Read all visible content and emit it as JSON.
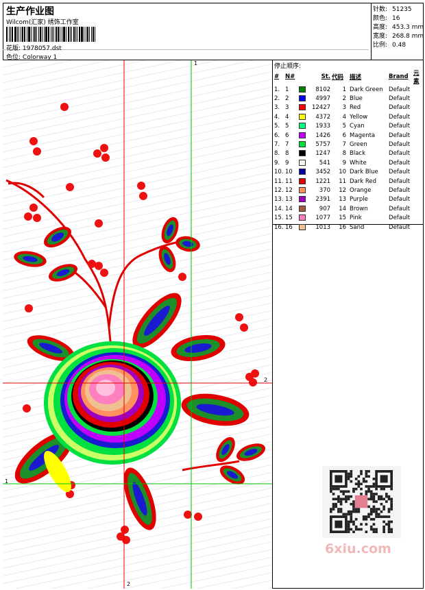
{
  "header": {
    "title": "生产作业图",
    "subtitle": "Wilcom(汇家) 绣饰工作室",
    "pattern_label": "花版:",
    "pattern_value": "1978057.dst",
    "colorway_label": "色位:",
    "colorway_value": "Colorway 1"
  },
  "stats": [
    {
      "label": "针数:",
      "value": "51235"
    },
    {
      "label": "颜色:",
      "value": "16"
    },
    {
      "label": "高度:",
      "value": "453.3 mm"
    },
    {
      "label": "宽度:",
      "value": "268.8 mm"
    },
    {
      "label": "比例:",
      "value": "0.48"
    }
  ],
  "canvas": {
    "axis_labels": {
      "v1_top": "1",
      "h1_left": "1",
      "h2_right": "2",
      "v2_bottom": "2"
    },
    "colors": {
      "red_guide": "#e00000",
      "green_guide": "#00c000"
    }
  },
  "stop_panel": {
    "title": "停止顺序:",
    "headers": [
      "#",
      "N#",
      "St.",
      "代码",
      "描述",
      "Brand",
      "元素"
    ],
    "rows": [
      {
        "num": "1.",
        "n": "1",
        "color": "#008000",
        "st": "8102",
        "code": "1",
        "desc": "Dark Green",
        "brand": "Default"
      },
      {
        "num": "2.",
        "n": "2",
        "color": "#0000ff",
        "st": "4997",
        "code": "2",
        "desc": "Blue",
        "brand": "Default"
      },
      {
        "num": "3.",
        "n": "3",
        "color": "#ff0000",
        "st": "12427",
        "code": "3",
        "desc": "Red",
        "brand": "Default"
      },
      {
        "num": "4.",
        "n": "4",
        "color": "#ffff00",
        "st": "4372",
        "code": "4",
        "desc": "Yellow",
        "brand": "Default"
      },
      {
        "num": "5.",
        "n": "5",
        "color": "#00ff80",
        "st": "1933",
        "code": "5",
        "desc": "Cyan",
        "brand": "Default"
      },
      {
        "num": "6.",
        "n": "6",
        "color": "#c000ff",
        "st": "1426",
        "code": "6",
        "desc": "Magenta",
        "brand": "Default"
      },
      {
        "num": "7.",
        "n": "7",
        "color": "#00e040",
        "st": "5757",
        "code": "7",
        "desc": "Green",
        "brand": "Default"
      },
      {
        "num": "8.",
        "n": "8",
        "color": "#000000",
        "st": "1247",
        "code": "8",
        "desc": "Black",
        "brand": "Default"
      },
      {
        "num": "9.",
        "n": "9",
        "color": "#f8f8f0",
        "st": "541",
        "code": "9",
        "desc": "White",
        "brand": "Default"
      },
      {
        "num": "10.",
        "n": "10",
        "color": "#0000a0",
        "st": "3452",
        "code": "10",
        "desc": "Dark Blue",
        "brand": "Default"
      },
      {
        "num": "11.",
        "n": "11",
        "color": "#e00000",
        "st": "1221",
        "code": "11",
        "desc": "Dark Red",
        "brand": "Default"
      },
      {
        "num": "12.",
        "n": "12",
        "color": "#ff9060",
        "st": "370",
        "code": "12",
        "desc": "Orange",
        "brand": "Default"
      },
      {
        "num": "13.",
        "n": "13",
        "color": "#a000c0",
        "st": "2391",
        "code": "13",
        "desc": "Purple",
        "brand": "Default"
      },
      {
        "num": "14.",
        "n": "14",
        "color": "#a06040",
        "st": "907",
        "code": "14",
        "desc": "Brown",
        "brand": "Default"
      },
      {
        "num": "15.",
        "n": "15",
        "color": "#ff80c0",
        "st": "1077",
        "code": "15",
        "desc": "Pink",
        "brand": "Default"
      },
      {
        "num": "16.",
        "n": "16",
        "color": "#f0c090",
        "st": "1013",
        "code": "16",
        "desc": "Sand",
        "brand": "Default"
      }
    ]
  },
  "watermark": {
    "text": "6xiu.com"
  }
}
